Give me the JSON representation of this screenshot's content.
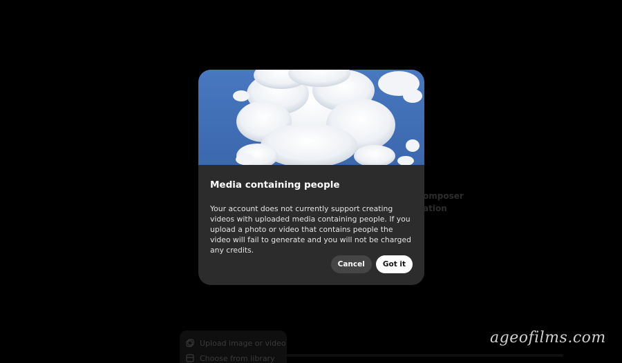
{
  "background": {
    "composer_text": "omposer",
    "station_text": "ation",
    "menu": [
      {
        "label": "Upload image or video",
        "icon": "upload-media-icon"
      },
      {
        "label": "Choose from library",
        "icon": "library-icon"
      }
    ]
  },
  "modal": {
    "image_icon": "cloud-sky-image",
    "title": "Media containing people",
    "message": "Your account does not currently support creating videos with uploaded media containing people. If you upload a photo or video that contains people the video will fail to generate and you will not be charged any credits.",
    "cancel_label": "Cancel",
    "confirm_label": "Got it"
  },
  "watermark": {
    "text": "ageofilms.com"
  },
  "colors": {
    "backdrop": "#000000",
    "modal_background": "#2c2c2c",
    "sky": "#3f6fb8",
    "cancel_button": "#454545",
    "confirm_button": "#ffffff"
  }
}
